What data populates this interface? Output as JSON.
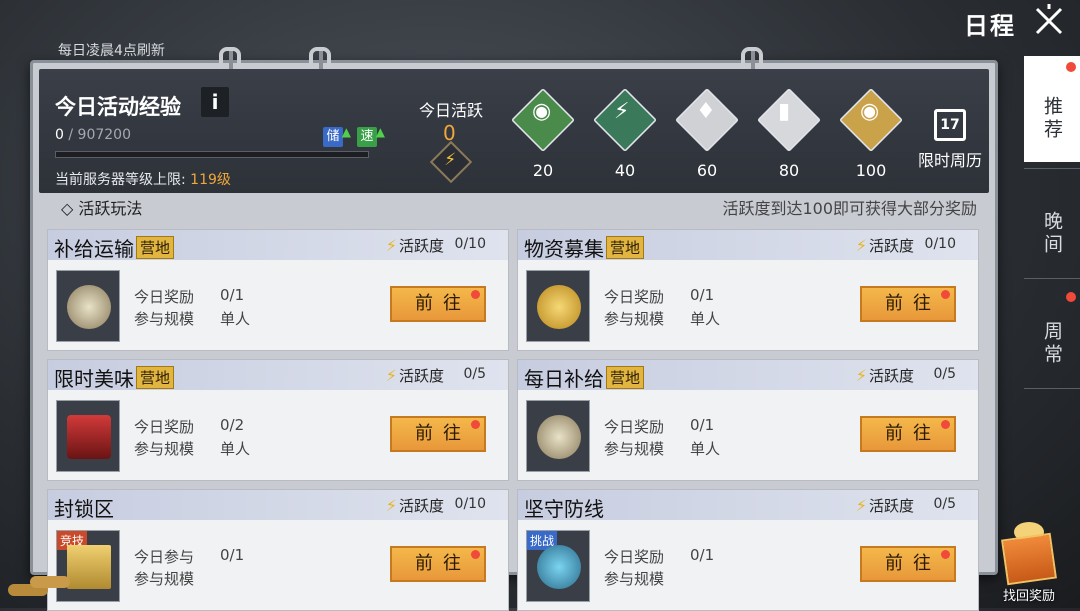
{
  "header": {
    "title": "日程",
    "close_icon": "close-icon"
  },
  "refresh_note": "每日凌晨4点刷新",
  "exp": {
    "title": "今日活动经验",
    "info": "i",
    "current": "0",
    "max": "/ 907200",
    "progress_fraction": 0,
    "badge_store": "储",
    "badge_speed": "速",
    "server_level_label": "当前服务器等级上限: ",
    "server_level_value": "119级"
  },
  "activity": {
    "label": "今日活跃",
    "value": "0",
    "chests": [
      {
        "value": "20",
        "color": "#4a8a4a",
        "icon": "silver-coin-icon"
      },
      {
        "value": "40",
        "color": "#3a7a5a",
        "icon": "lightning-crate-icon"
      },
      {
        "value": "60",
        "color": "#cfd1d5",
        "icon": "wing-emblem-icon"
      },
      {
        "value": "80",
        "color": "#d6d8dc",
        "icon": "ammo-crate-icon"
      },
      {
        "value": "100",
        "color": "#caa24a",
        "icon": "gold-coin-icon"
      }
    ],
    "calendar_day": "17",
    "limited_weekly": "限时周历"
  },
  "section": {
    "title": "◇ 活跃玩法",
    "hint": "活跃度到达100即可获得大部分奖励"
  },
  "cards": [
    {
      "name": "补给运输",
      "tag": "营地",
      "act_label": "活跃度",
      "progress": "0/10",
      "reward_label": "今日奖励",
      "reward_value": "0/1",
      "scale_label": "参与规模",
      "scale_value": "单人",
      "button": "前往",
      "thumb": "wing-emblem"
    },
    {
      "name": "物资募集",
      "tag": "营地",
      "act_label": "活跃度",
      "progress": "0/10",
      "reward_label": "今日奖励",
      "reward_value": "0/1",
      "scale_label": "参与规模",
      "scale_value": "单人",
      "button": "前往",
      "thumb": "gold-coin"
    },
    {
      "name": "限时美味",
      "tag": "营地",
      "act_label": "活跃度",
      "progress": "0/5",
      "reward_label": "今日奖励",
      "reward_value": "0/2",
      "scale_label": "参与规模",
      "scale_value": "单人",
      "button": "前往",
      "thumb": "red-crate"
    },
    {
      "name": "每日补给",
      "tag": "营地",
      "act_label": "活跃度",
      "progress": "0/5",
      "reward_label": "今日奖励",
      "reward_value": "0/1",
      "scale_label": "参与规模",
      "scale_value": "单人",
      "button": "前往",
      "thumb": "wing-emblem"
    },
    {
      "name": "封锁区",
      "tag": "",
      "corner": "竞技",
      "act_label": "活跃度",
      "progress": "0/10",
      "reward_label": "今日参与",
      "reward_value": "0/1",
      "scale_label": "参与规模",
      "scale_value": "",
      "button": "前往",
      "thumb": "gold-bars"
    },
    {
      "name": "坚守防线",
      "tag": "",
      "corner": "挑战",
      "act_label": "活跃度",
      "progress": "0/5",
      "reward_label": "今日奖励",
      "reward_value": "0/1",
      "scale_label": "参与规模",
      "scale_value": "",
      "button": "前往",
      "thumb": "blue-shield"
    }
  ],
  "side_tabs": [
    {
      "label": "推荐",
      "active": true,
      "dot": true
    },
    {
      "label": "晚间",
      "active": false,
      "dot": false
    },
    {
      "label": "周常",
      "active": false,
      "dot": true
    }
  ],
  "gift": {
    "label": "找回奖励"
  }
}
